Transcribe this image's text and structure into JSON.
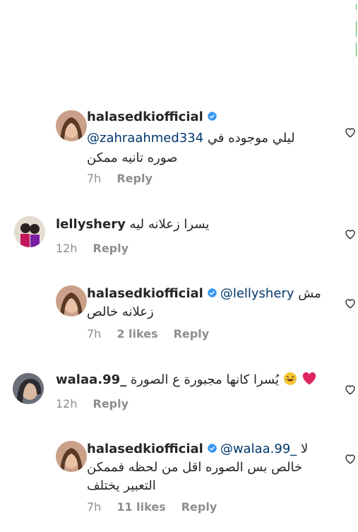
{
  "comments": [
    {
      "username": "halasedkiofficial",
      "verified": true,
      "mention": "@zahraahmed334",
      "text_line1": "ليلي موجوده في",
      "text_line2": "صوره تانيه ممكن",
      "time": "7h",
      "likes": "",
      "reply": "Reply"
    },
    {
      "username": "lellyshery",
      "verified": false,
      "text_line1": "يسرا زعلانه ليه",
      "time": "12h",
      "likes": "",
      "reply": "Reply"
    },
    {
      "username": "halasedkiofficial",
      "verified": true,
      "mention": "@lellyshery",
      "text_line1": "مش",
      "text_line2": "زعلانه خالص",
      "time": "7h",
      "likes": "2 likes",
      "reply": "Reply"
    },
    {
      "username": "walaa.99_",
      "verified": false,
      "text_line1": "يُسرا كانها مجبورة ع الصورة",
      "time": "12h",
      "likes": "",
      "reply": "Reply"
    },
    {
      "username": "halasedkiofficial",
      "verified": true,
      "mention": "@walaa.99_",
      "text_line1": "لا",
      "text_line2": "خالص بس الصوره اقل من لحظه فممكن",
      "text_line3": "التعبير يختلف",
      "time": "7h",
      "likes": "11 likes",
      "reply": "Reply"
    }
  ],
  "icons": {
    "verified": "verified-badge-icon",
    "like": "heart-outline-icon"
  },
  "colors": {
    "text": "#262626",
    "secondary": "#8e8e8e",
    "mention": "#00376b",
    "verified": "#3897f0"
  }
}
